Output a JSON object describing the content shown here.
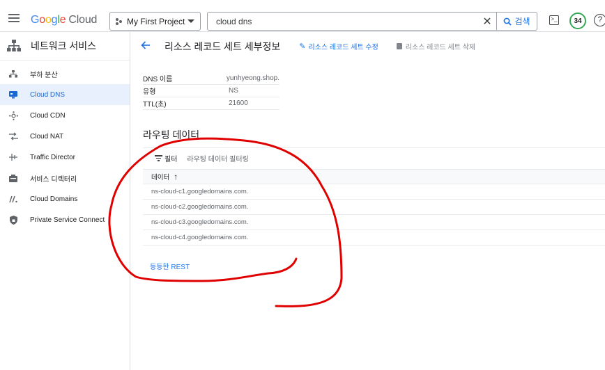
{
  "header": {
    "logo_google": "Google",
    "logo_cloud": "Cloud",
    "project": "My First Project",
    "search_value": "cloud dns",
    "search_button": "검색",
    "notification_count": "34",
    "help": "?",
    "terminal_glyph": ">_"
  },
  "sidebar": {
    "title": "네트워크 서비스",
    "items": [
      {
        "label": "부하 분산",
        "icon": "load-balancing-icon"
      },
      {
        "label": "Cloud DNS",
        "icon": "cloud-dns-icon",
        "active": true
      },
      {
        "label": "Cloud CDN",
        "icon": "cloud-cdn-icon"
      },
      {
        "label": "Cloud NAT",
        "icon": "cloud-nat-icon"
      },
      {
        "label": "Traffic Director",
        "icon": "traffic-director-icon"
      },
      {
        "label": "서비스 디렉터리",
        "icon": "service-directory-icon"
      },
      {
        "label": "Cloud Domains",
        "icon": "cloud-domains-icon"
      },
      {
        "label": "Private Service Connect",
        "icon": "private-service-connect-icon"
      }
    ]
  },
  "page": {
    "title": "리소스 레코드 세트 세부정보",
    "edit_label": "리소스 레코드 세트 수정",
    "delete_label": "리소스 레코드 세트 삭제"
  },
  "details": {
    "rows": [
      {
        "key": "DNS 이름",
        "value": "yunhyeong.shop."
      },
      {
        "key": "유형",
        "value": "NS"
      },
      {
        "key": "TTL(초)",
        "value": "21600"
      }
    ]
  },
  "routing": {
    "title": "라우팅 데이터",
    "filter_label": "필터",
    "filter_placeholder": "라우팅 데이터 필터링",
    "column_header": "데이터",
    "sort_arrow": "↑",
    "rows": [
      "ns-cloud-c1.googledomains.com.",
      "ns-cloud-c2.googledomains.com.",
      "ns-cloud-c3.googledomains.com.",
      "ns-cloud-c4.googledomains.com."
    ],
    "rest_link": "등등한 REST"
  },
  "colors": {
    "accent": "#1a73e8",
    "annotation": "#e00000"
  }
}
